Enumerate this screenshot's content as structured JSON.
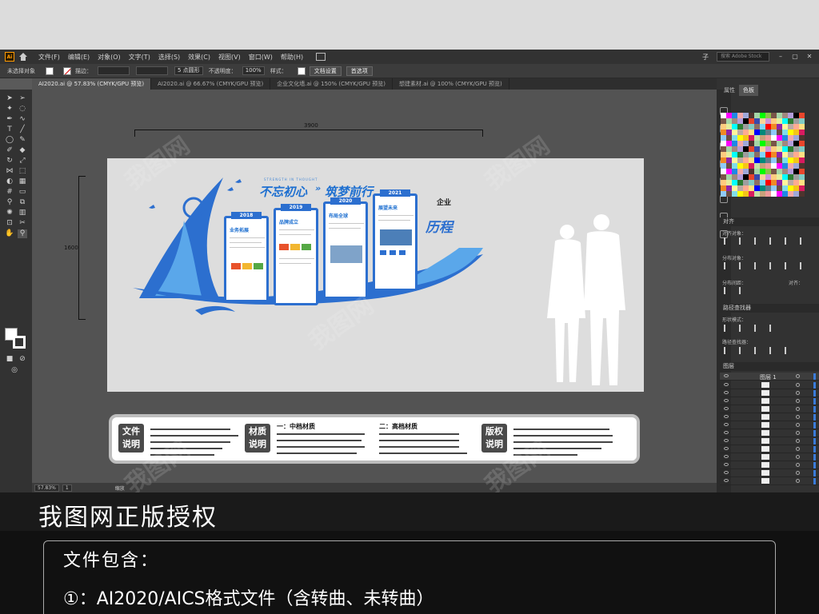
{
  "menubar": {
    "items": [
      "文件(F)",
      "编辑(E)",
      "对象(O)",
      "文字(T)",
      "选择(S)",
      "效果(C)",
      "视图(V)",
      "窗口(W)",
      "帮助(H)"
    ],
    "right_label": "子",
    "search_placeholder": "搜索 Adobe Stock"
  },
  "controlbar": {
    "selection_label": "未选择对象",
    "stroke_label": "描边：",
    "brush_value": "5 点圆形",
    "opacity_label": "不透明度：",
    "opacity_value": "100%",
    "style_label": "样式：",
    "doc_settings": "文档设置",
    "preferences": "首选项"
  },
  "tabs": [
    {
      "label": "AI2020.ai @ 57.83% (CMYK/GPU 预览)",
      "active": true
    },
    {
      "label": "AI2020.ai @ 66.67% (CMYK/GPU 预览)",
      "active": false
    },
    {
      "label": "企业文化墙.ai @ 150% (CMYK/GPU 预览)",
      "active": false
    },
    {
      "label": "想建素材.ai @ 100% (CMYK/GPU 预览)",
      "active": false
    }
  ],
  "artwork": {
    "dim_width": "3900",
    "dim_height": "1600",
    "slogan_left": "不忘初心",
    "slogan_arrows": "»",
    "slogan_right": "筑梦前行",
    "slogan_sub": "STRENGTH IN THOUGHT",
    "panels": [
      {
        "year": "2018",
        "heading": "业务拓展"
      },
      {
        "year": "2019",
        "heading": "品牌成立"
      },
      {
        "year": "2020",
        "heading": "布局全球"
      },
      {
        "year": "2021",
        "heading": "展望未来"
      }
    ],
    "qiye": "企业",
    "history": "历程"
  },
  "info": {
    "tag1": "文件说明",
    "tag2": "材质说明",
    "tag3": "版权说明",
    "head_mid": "一：中档材质",
    "head_high": "二：高档材质"
  },
  "statusbar": {
    "zoom": "57.83%",
    "page": "1",
    "mode": "缩放"
  },
  "rightpanel": {
    "tab_properties": "属性",
    "tab_swatches": "色板",
    "align_head": "对齐",
    "align_objects": "对齐对象：",
    "distribute_objects": "分布对象：",
    "distribute_spacing": "分布间距：",
    "align_to": "对齐：",
    "pathfinder_head": "路径查找器",
    "shape_modes": "形状模式：",
    "pathfinder": "路径查找器：",
    "layers_head": "图层",
    "layer1": "图层 1"
  },
  "colors": {
    "accent_blue": "#2c6fcf",
    "canvas_gray": "#535353"
  },
  "banner": {
    "title": "我图网正版授权"
  },
  "contents": {
    "heading": "文件包含：",
    "item1": "①：AI2020/AICS格式文件（含转曲、未转曲）"
  },
  "watermark": "我图网"
}
